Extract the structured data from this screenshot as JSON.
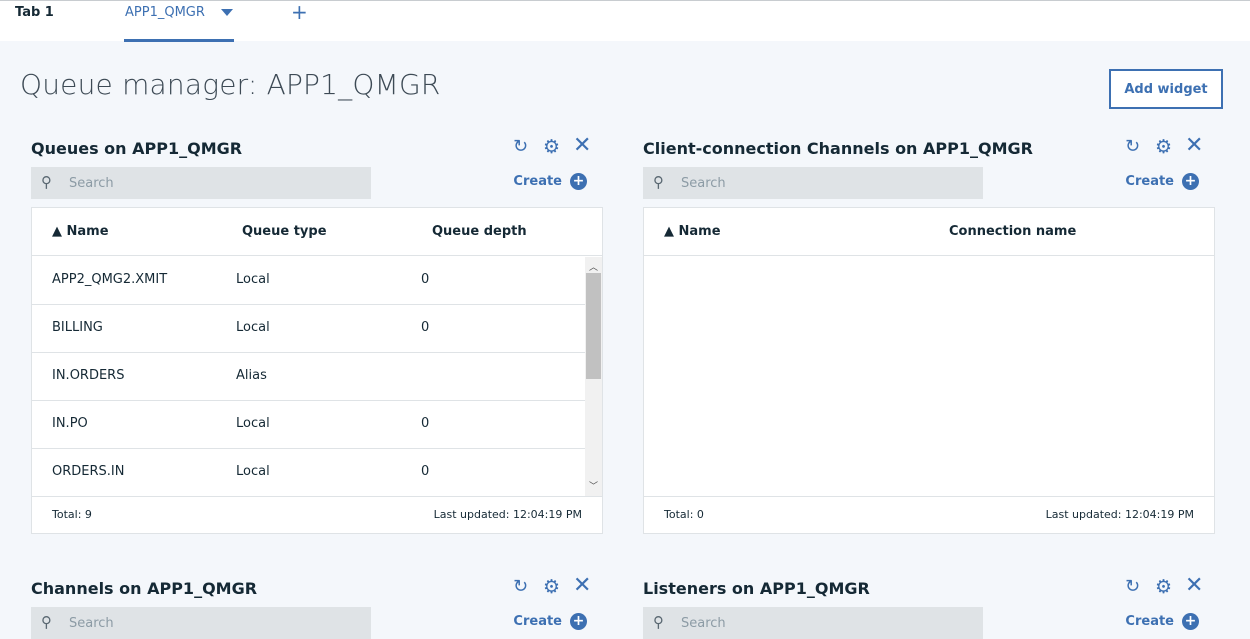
{
  "tabs": {
    "tab1": "Tab 1",
    "tab2": "APP1_QMGR",
    "add_tab": "+"
  },
  "page": {
    "title": "Queue manager: APP1_QMGR",
    "add_widget": "Add widget"
  },
  "colors": {
    "accent": "#3d70b2",
    "background": "#f4f7fb",
    "search_bg": "#dfe3e6"
  },
  "icons": {
    "refresh": "refresh-icon",
    "settings": "gear-icon",
    "close": "close-icon",
    "search": "search-icon",
    "create": "plus-circle-icon",
    "sort": "sort-ascending-icon"
  },
  "queues": {
    "title": "Queues on APP1_QMGR",
    "search_placeholder": "Search",
    "create": "Create",
    "columns": [
      "▲ Name",
      "Queue type",
      "Queue depth"
    ],
    "rows": [
      {
        "name": "APP2_QMG2.XMIT",
        "type": "Local",
        "depth": "0"
      },
      {
        "name": "BILLING",
        "type": "Local",
        "depth": "0"
      },
      {
        "name": "IN.ORDERS",
        "type": "Alias",
        "depth": ""
      },
      {
        "name": "IN.PO",
        "type": "Local",
        "depth": "0"
      },
      {
        "name": "ORDERS.IN",
        "type": "Local",
        "depth": "0"
      }
    ],
    "total": "Total: 9",
    "updated": "Last updated: 12:04:19 PM"
  },
  "ccdt": {
    "title": "Client-connection Channels on APP1_QMGR",
    "search_placeholder": "Search",
    "create": "Create",
    "columns": [
      "▲ Name",
      "Connection name"
    ],
    "total": "Total: 0",
    "updated": "Last updated: 12:04:19 PM"
  },
  "channels": {
    "title": "Channels on APP1_QMGR",
    "search_placeholder": "Search",
    "create": "Create"
  },
  "listeners": {
    "title": "Listeners on APP1_QMGR",
    "search_placeholder": "Search",
    "create": "Create"
  }
}
